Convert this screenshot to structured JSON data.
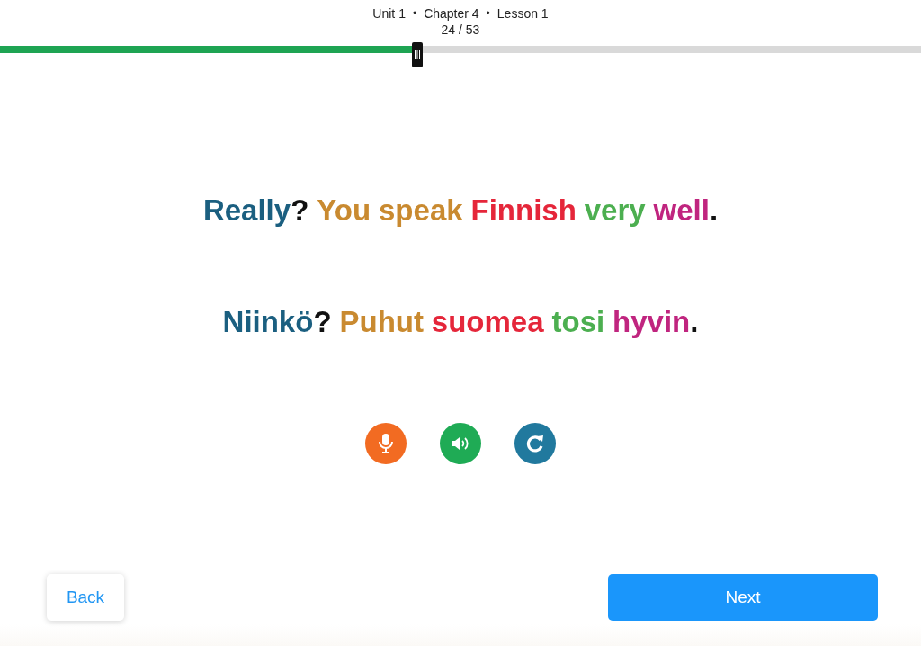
{
  "header": {
    "breadcrumb": [
      "Unit 1",
      "Chapter 4",
      "Lesson 1"
    ],
    "separator": "•",
    "counter": "24 / 53"
  },
  "progress": {
    "level": 0.4528
  },
  "sentences": [
    {
      "words": [
        {
          "text": "Really",
          "color": "#1b5f80",
          "punct": "?"
        },
        {
          "text": "You",
          "color": "#c98a30"
        },
        {
          "text": "speak",
          "color": "#c98a30"
        },
        {
          "text": "Finnish",
          "color": "#e5263a"
        },
        {
          "text": "very",
          "color": "#4caf50"
        },
        {
          "text": "well",
          "color": "#c0257f",
          "punct": "."
        }
      ]
    },
    {
      "words": [
        {
          "text": "Niinkö",
          "color": "#1b5f80",
          "punct": "?"
        },
        {
          "text": "Puhut",
          "color": "#c98a30"
        },
        {
          "text": "suomea",
          "color": "#e5263a"
        },
        {
          "text": "tosi",
          "color": "#4caf50"
        },
        {
          "text": "hyvin",
          "color": "#c0257f",
          "punct": "."
        }
      ]
    }
  ],
  "actions": [
    {
      "kind": "microphone",
      "color": "#f26b22"
    },
    {
      "kind": "speaker",
      "color": "#1fab55"
    },
    {
      "kind": "replay",
      "color": "#21799e"
    }
  ],
  "back_button": "Back",
  "next_button": "Next"
}
